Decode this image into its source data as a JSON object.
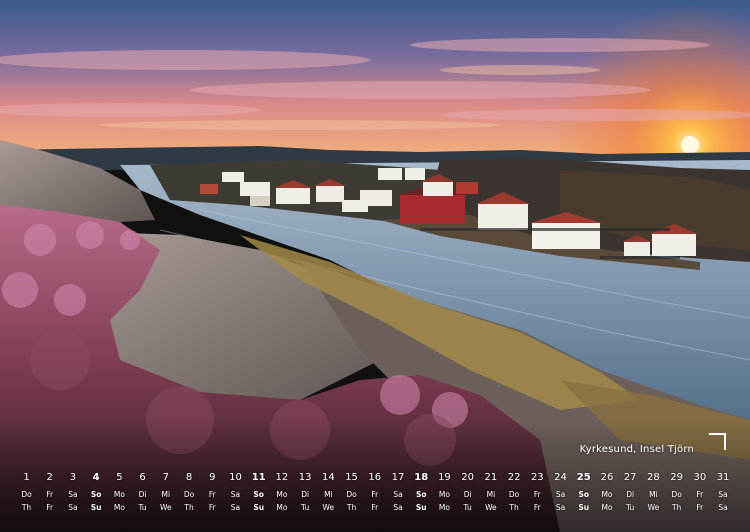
{
  "caption": "Kyrkesund, Insel Tjörn",
  "calendar": {
    "days": [
      {
        "num": "1",
        "wd1": "Do",
        "wd2": "Th",
        "sunday": false
      },
      {
        "num": "2",
        "wd1": "Fr",
        "wd2": "Fr",
        "sunday": false
      },
      {
        "num": "3",
        "wd1": "Sa",
        "wd2": "Sa",
        "sunday": false
      },
      {
        "num": "4",
        "wd1": "So",
        "wd2": "Su",
        "sunday": true
      },
      {
        "num": "5",
        "wd1": "Mo",
        "wd2": "Mo",
        "sunday": false
      },
      {
        "num": "6",
        "wd1": "Di",
        "wd2": "Tu",
        "sunday": false
      },
      {
        "num": "7",
        "wd1": "Mi",
        "wd2": "We",
        "sunday": false
      },
      {
        "num": "8",
        "wd1": "Do",
        "wd2": "Th",
        "sunday": false
      },
      {
        "num": "9",
        "wd1": "Fr",
        "wd2": "Fr",
        "sunday": false
      },
      {
        "num": "10",
        "wd1": "Sa",
        "wd2": "Sa",
        "sunday": false
      },
      {
        "num": "11",
        "wd1": "So",
        "wd2": "Su",
        "sunday": true
      },
      {
        "num": "12",
        "wd1": "Mo",
        "wd2": "Mo",
        "sunday": false
      },
      {
        "num": "13",
        "wd1": "Di",
        "wd2": "Tu",
        "sunday": false
      },
      {
        "num": "14",
        "wd1": "Mi",
        "wd2": "We",
        "sunday": false
      },
      {
        "num": "15",
        "wd1": "Do",
        "wd2": "Th",
        "sunday": false
      },
      {
        "num": "16",
        "wd1": "Fr",
        "wd2": "Fr",
        "sunday": false
      },
      {
        "num": "17",
        "wd1": "Sa",
        "wd2": "Sa",
        "sunday": false
      },
      {
        "num": "18",
        "wd1": "So",
        "wd2": "Su",
        "sunday": true
      },
      {
        "num": "19",
        "wd1": "Mo",
        "wd2": "Mo",
        "sunday": false
      },
      {
        "num": "20",
        "wd1": "Di",
        "wd2": "Tu",
        "sunday": false
      },
      {
        "num": "21",
        "wd1": "Mi",
        "wd2": "We",
        "sunday": false
      },
      {
        "num": "22",
        "wd1": "Do",
        "wd2": "Th",
        "sunday": false
      },
      {
        "num": "23",
        "wd1": "Fr",
        "wd2": "Fr",
        "sunday": false
      },
      {
        "num": "24",
        "wd1": "Sa",
        "wd2": "Sa",
        "sunday": false
      },
      {
        "num": "25",
        "wd1": "So",
        "wd2": "Su",
        "sunday": true
      },
      {
        "num": "26",
        "wd1": "Mo",
        "wd2": "Mo",
        "sunday": false
      },
      {
        "num": "27",
        "wd1": "Di",
        "wd2": "Tu",
        "sunday": false
      },
      {
        "num": "28",
        "wd1": "Mi",
        "wd2": "We",
        "sunday": false
      },
      {
        "num": "29",
        "wd1": "Do",
        "wd2": "Th",
        "sunday": false
      },
      {
        "num": "30",
        "wd1": "Fr",
        "wd2": "Fr",
        "sunday": false
      },
      {
        "num": "31",
        "wd1": "Sa",
        "wd2": "Sa",
        "sunday": false
      }
    ]
  }
}
